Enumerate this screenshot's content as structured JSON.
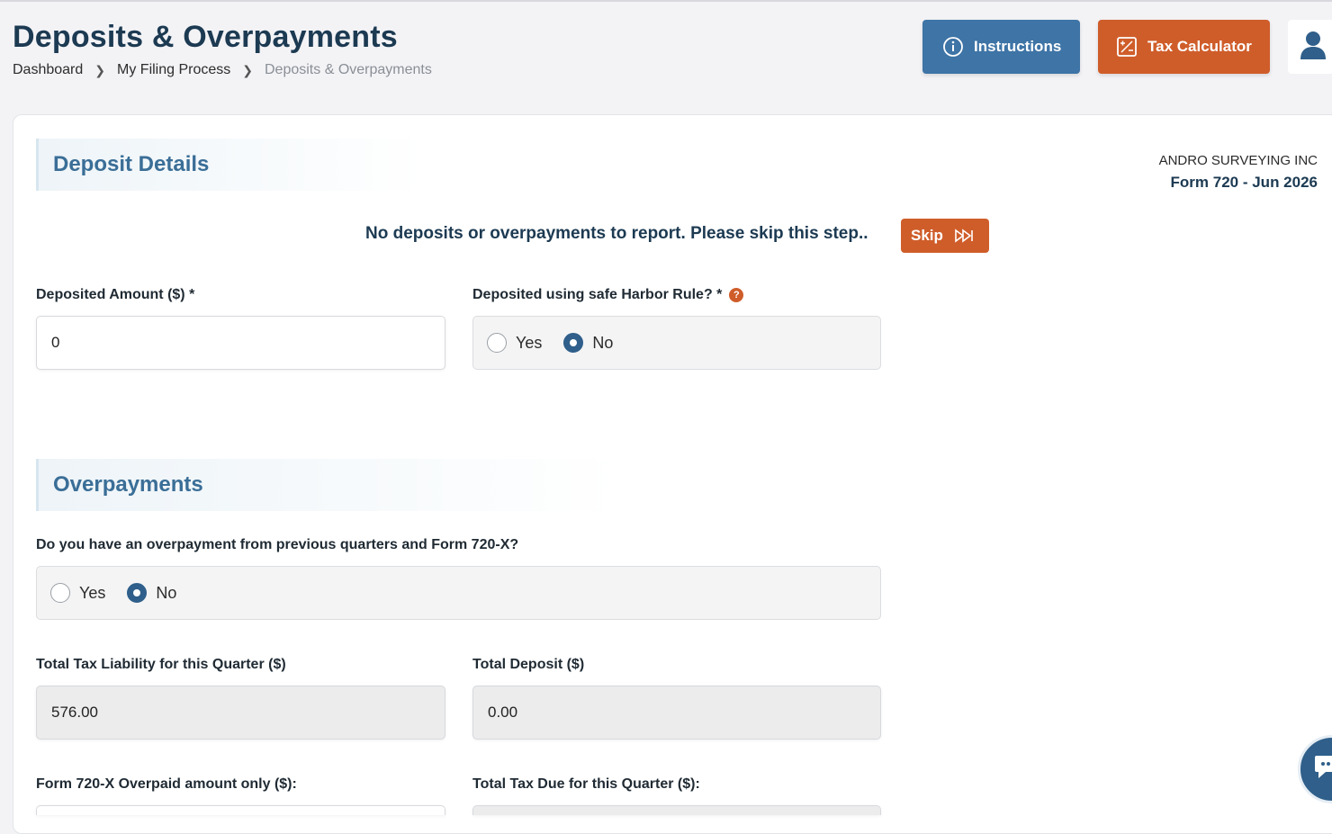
{
  "header": {
    "title": "Deposits & Overpayments",
    "breadcrumb": [
      "Dashboard",
      "My Filing Process",
      "Deposits & Overpayments"
    ],
    "instructions_label": "Instructions",
    "tax_calculator_label": "Tax Calculator"
  },
  "company": {
    "name": "ANDRO SURVEYING INC",
    "form": "Form 720 - Jun 2026"
  },
  "deposit_details": {
    "heading": "Deposit Details",
    "notice": "No deposits or overpayments to report. Please skip this step..",
    "skip_label": "Skip",
    "deposited_amount_label": "Deposited Amount ($) *",
    "deposited_amount_value": "0",
    "safe_harbor_label": "Deposited using safe Harbor Rule? *",
    "help_glyph": "?",
    "safe_harbor_options": [
      "Yes",
      "No"
    ],
    "safe_harbor_selected": "No"
  },
  "overpayments": {
    "heading": "Overpayments",
    "question": "Do you have an overpayment from previous quarters and Form 720-X?",
    "options": [
      "Yes",
      "No"
    ],
    "selected": "No",
    "total_tax_liability_label": "Total Tax Liability for this Quarter ($)",
    "total_tax_liability_value": "576.00",
    "total_deposit_label": "Total Deposit ($)",
    "total_deposit_value": "0.00",
    "overpaid_label": "Form 720-X Overpaid amount only ($):",
    "total_tax_due_label": "Total Tax Due for this Quarter ($):"
  },
  "colors": {
    "primary": "#3e74a6",
    "accent": "#cf5d2a",
    "heading": "#1c3a52",
    "section_heading": "#3a6e97"
  },
  "icons": {
    "instructions": "info-icon",
    "tax_calculator": "calculator-icon",
    "user": "user-icon",
    "skip": "fast-forward-icon",
    "chat": "chat-icon"
  }
}
